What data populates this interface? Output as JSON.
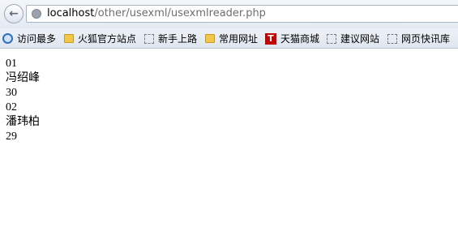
{
  "browser": {
    "url_host": "localhost",
    "url_path": "/other/usexml/usexmlreader.php"
  },
  "bookmarks": [
    {
      "label": "访问最多",
      "icon": "search-icon"
    },
    {
      "label": "火狐官方站点",
      "icon": "folder-icon"
    },
    {
      "label": "新手上路",
      "icon": "page-icon"
    },
    {
      "label": "常用网址",
      "icon": "folder-icon"
    },
    {
      "label": "天猫商城",
      "icon": "tmall-icon",
      "icon_text": "T"
    },
    {
      "label": "建议网站",
      "icon": "page-icon"
    },
    {
      "label": "网页快讯库",
      "icon": "page-icon"
    }
  ],
  "page": {
    "lines": [
      "01",
      "冯绍峰",
      "30",
      "02",
      "潘玮柏",
      "29"
    ]
  }
}
